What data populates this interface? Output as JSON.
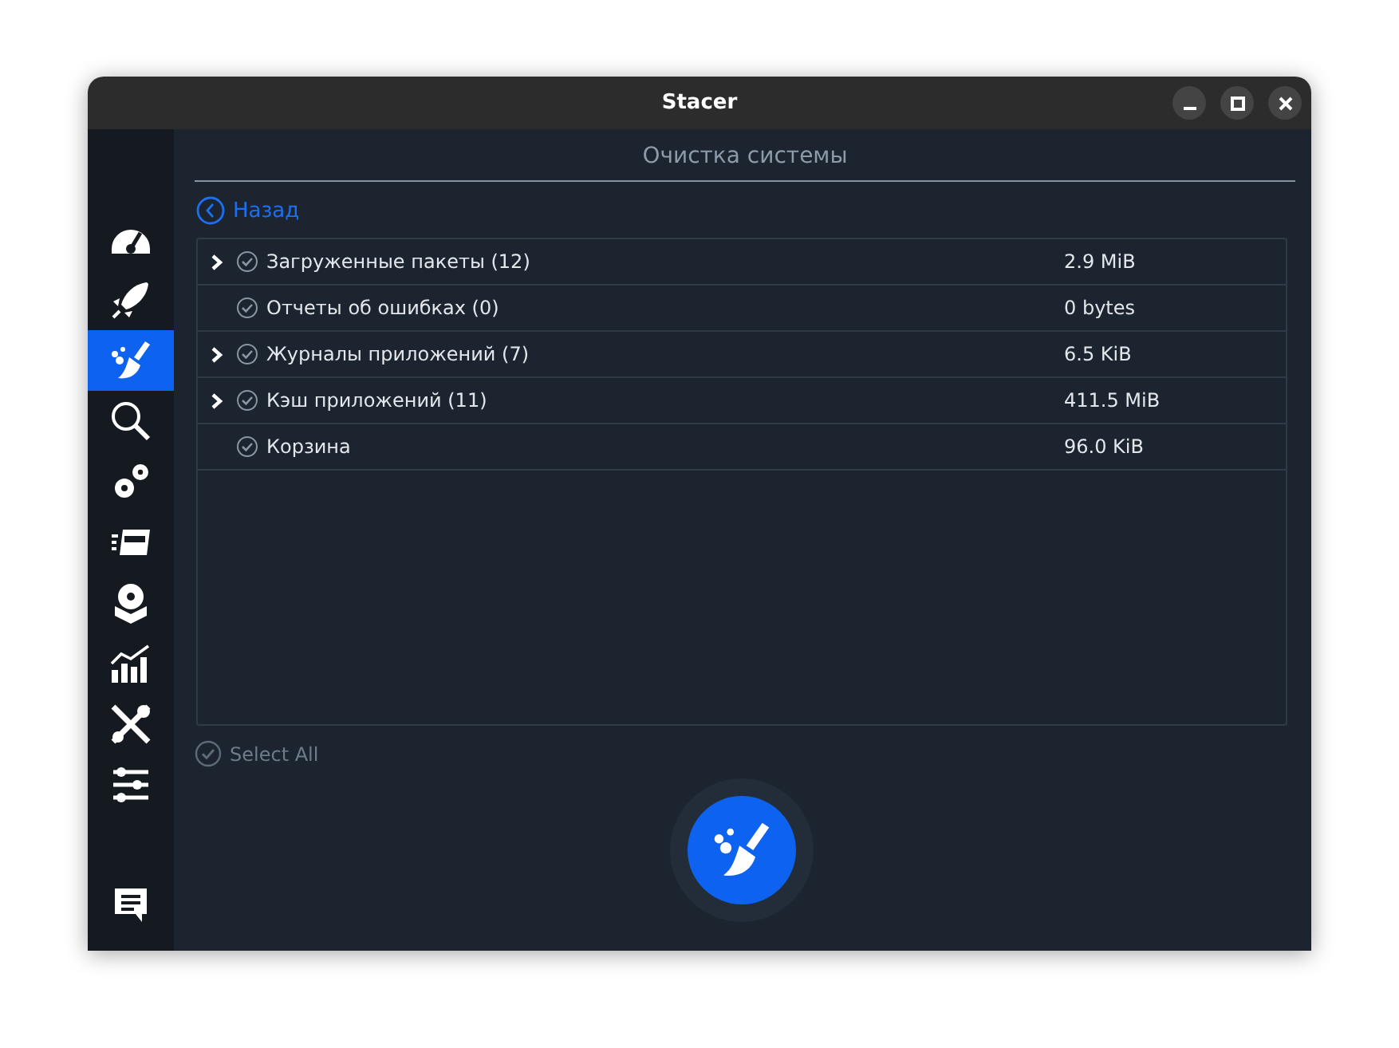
{
  "window": {
    "title": "Stacer"
  },
  "sidebar": {
    "items": [
      {
        "selected": false
      },
      {
        "selected": false
      },
      {
        "selected": true
      },
      {
        "selected": false
      },
      {
        "selected": false
      },
      {
        "selected": false
      },
      {
        "selected": false
      },
      {
        "selected": false
      },
      {
        "selected": false
      },
      {
        "selected": false
      }
    ],
    "feedback": {
      "selected": false
    }
  },
  "page": {
    "title": "Очистка системы",
    "back": "Назад"
  },
  "rows": [
    {
      "name": "Загруженные пакеты (12)",
      "size": "2.9 MiB",
      "expandable": true,
      "checked": true
    },
    {
      "name": "Отчеты об ошибках (0)",
      "size": "0 bytes",
      "expandable": false,
      "checked": true
    },
    {
      "name": "Журналы приложений (7)",
      "size": "6.5 KiB",
      "expandable": true,
      "checked": true
    },
    {
      "name": "Кэш приложений (11)",
      "size": "411.5 MiB",
      "expandable": true,
      "checked": true
    },
    {
      "name": "Корзина",
      "size": "96.0 KiB",
      "expandable": false,
      "checked": true
    }
  ],
  "select_all": {
    "label": "Select All",
    "checked": true
  }
}
